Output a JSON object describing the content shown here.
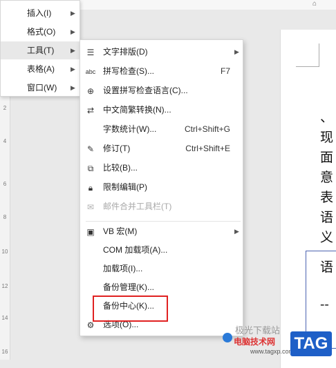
{
  "topbar": {
    "home_icon": "⌂"
  },
  "ruler": {
    "ticks": [
      "2",
      "4",
      "6",
      "8",
      "10",
      "12",
      "14",
      "16"
    ]
  },
  "document": {
    "lines": [
      "、",
      "现",
      "面",
      "意",
      "表",
      "语",
      "义"
    ],
    "box_lines": [
      "语",
      "--"
    ]
  },
  "menu1": {
    "items": [
      {
        "label": "插入(I)"
      },
      {
        "label": "格式(O)"
      },
      {
        "label": "工具(T)"
      },
      {
        "label": "表格(A)"
      },
      {
        "label": "窗口(W)"
      }
    ]
  },
  "menu2": {
    "items": [
      {
        "label": "文字排版(D)",
        "icon": "text-layout-icon",
        "shortcut": ""
      },
      {
        "label": "拼写检查(S)...",
        "icon": "spell-check-icon",
        "shortcut": "F7"
      },
      {
        "label": "设置拼写检查语言(C)...",
        "icon": "spell-language-icon",
        "shortcut": ""
      },
      {
        "label": "中文简繁转换(N)...",
        "icon": "chinese-convert-icon",
        "shortcut": ""
      },
      {
        "label": "字数统计(W)...",
        "icon": "",
        "shortcut": "Ctrl+Shift+G"
      },
      {
        "label": "修订(T)",
        "icon": "revision-icon",
        "shortcut": "Ctrl+Shift+E"
      },
      {
        "label": "比较(B)...",
        "icon": "compare-icon",
        "shortcut": ""
      },
      {
        "label": "限制编辑(P)",
        "icon": "lock-icon",
        "shortcut": ""
      },
      {
        "label": "邮件合并工具栏(T)",
        "icon": "mail-icon",
        "shortcut": ""
      },
      {
        "label": "VB 宏(M)",
        "icon": "macro-icon",
        "shortcut": ""
      },
      {
        "label": "COM 加载项(A)...",
        "icon": "",
        "shortcut": ""
      },
      {
        "label": "加载项(I)...",
        "icon": "",
        "shortcut": ""
      },
      {
        "label": "备份管理(K)...",
        "icon": "",
        "shortcut": ""
      },
      {
        "label": "备份中心(K)...",
        "icon": "",
        "shortcut": ""
      },
      {
        "label": "选项(O)...",
        "icon": "gear-icon",
        "shortcut": ""
      }
    ]
  },
  "watermark": {
    "top_text": "极光下载站",
    "site_text": "电脑技术网",
    "url": "www.tagxp.com",
    "tag": "TAG"
  },
  "colors": {
    "highlight": "#e02020",
    "tag_bg": "#1e5fc7"
  }
}
